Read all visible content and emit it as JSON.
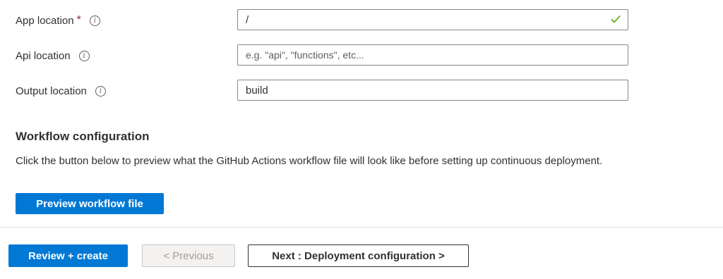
{
  "fields": [
    {
      "label": "App location",
      "required_marker": "*",
      "value": "/",
      "placeholder": "",
      "valid": true
    },
    {
      "label": "Api location",
      "required_marker": "",
      "value": "",
      "placeholder": "e.g. \"api\", \"functions\", etc...",
      "valid": false
    },
    {
      "label": "Output location",
      "required_marker": "",
      "value": "build",
      "placeholder": "",
      "valid": false
    }
  ],
  "info_glyph": "i",
  "workflow": {
    "title": "Workflow configuration",
    "description": "Click the button below to preview what the GitHub Actions workflow file will look like before setting up continuous deployment.",
    "preview_button": "Preview workflow file"
  },
  "footer": {
    "review_button": "Review + create",
    "previous_button": "< Previous",
    "next_button": "Next : Deployment configuration >"
  },
  "colors": {
    "accent": "#0078d4",
    "success": "#57a300",
    "required": "#a4262c"
  }
}
